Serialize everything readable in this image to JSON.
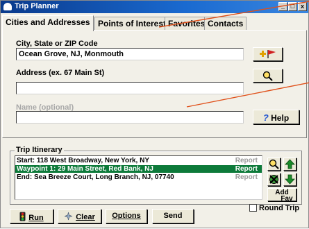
{
  "window": {
    "title": "Trip Planner",
    "controls": [
      "_",
      "□",
      "x"
    ]
  },
  "tabs": [
    {
      "label": "Cities and Addresses",
      "active": true
    },
    {
      "label": "Points of Interest",
      "active": false
    },
    {
      "label": "Favorites",
      "active": false
    },
    {
      "label": "Contacts",
      "active": false
    }
  ],
  "form": {
    "city_label": "City, State or ZIP Code",
    "city_value": "Ocean Grove, NJ, Monmouth",
    "address_label": "Address (ex. 67 Main St)",
    "address_value": "",
    "name_label": "Name (optional)",
    "name_value": ""
  },
  "buttons": {
    "help": "Help",
    "help_icon": "?",
    "run": "Run",
    "clear": "Clear",
    "options": "Options",
    "send": "Send",
    "add_fav_line1": "Add",
    "add_fav_line2": "Fav"
  },
  "itinerary": {
    "label": "Trip Itinerary",
    "rows": [
      {
        "text": "Start: 118 West Broadway, New York, NY",
        "report": "Report",
        "selected": false
      },
      {
        "text": "Waypoint 1: 29 Main Street, Red Bank, NJ",
        "report": "Report",
        "selected": true
      },
      {
        "text": "End: Sea Breeze Court, Long Branch, NJ, 07740",
        "report": "Report",
        "selected": false
      }
    ]
  },
  "round_trip": {
    "label": "Round Trip",
    "checked": false
  },
  "colors": {
    "title_bar": "#0a3a8c",
    "selection": "#0d7a3a",
    "callout_line": "#e0501a",
    "arrow_green": "#1a8a2a"
  },
  "icons": [
    "window-icon",
    "flag-add-icon",
    "magnifier-icon",
    "help-icon",
    "zoom-icon",
    "up-arrow-icon",
    "delete-icon",
    "down-arrow-icon",
    "traffic-light-icon",
    "eraser-icon"
  ]
}
